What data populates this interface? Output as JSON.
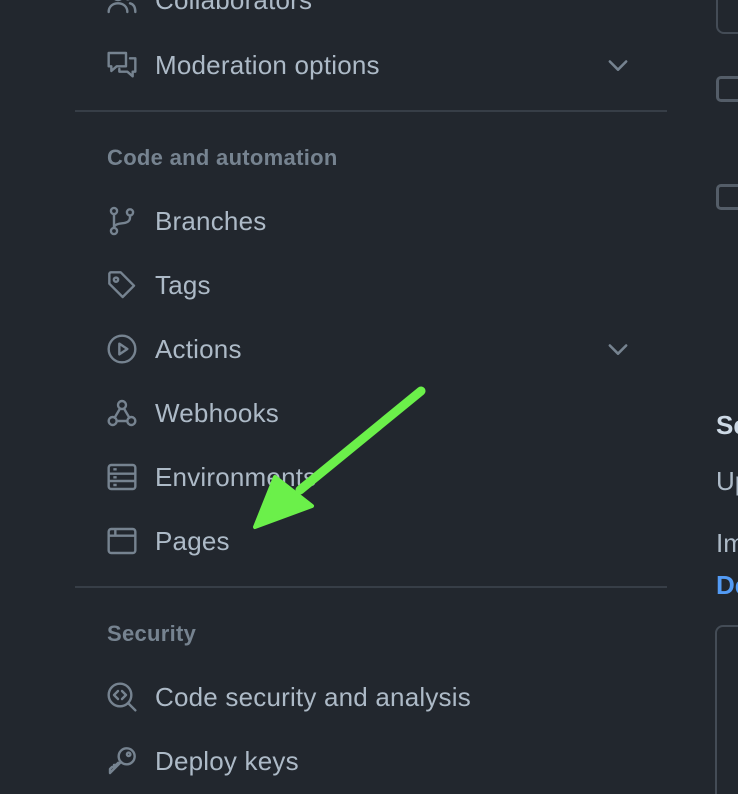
{
  "sidebar": {
    "items_top": [
      {
        "label": "Collaborators",
        "icon": "people-icon"
      },
      {
        "label": "Moderation options",
        "icon": "comment-discussion-icon",
        "expandable": true
      }
    ],
    "code_automation": {
      "heading": "Code and automation",
      "items": [
        {
          "label": "Branches",
          "icon": "git-branch-icon"
        },
        {
          "label": "Tags",
          "icon": "tag-icon"
        },
        {
          "label": "Actions",
          "icon": "play-icon",
          "expandable": true
        },
        {
          "label": "Webhooks",
          "icon": "webhook-icon"
        },
        {
          "label": "Environments",
          "icon": "server-icon"
        },
        {
          "label": "Pages",
          "icon": "browser-icon"
        }
      ]
    },
    "security": {
      "heading": "Security",
      "items": [
        {
          "label": "Code security and analysis",
          "icon": "codescan-icon"
        },
        {
          "label": "Deploy keys",
          "icon": "key-icon"
        }
      ]
    }
  },
  "right_panel": {
    "text_heading": "Se",
    "text_line1": "Up",
    "text_line2": "Im",
    "link_text": "De"
  },
  "colors": {
    "background": "#22272e",
    "text": "#adbac7",
    "muted": "#768390",
    "link": "#539bf5",
    "annotation_arrow": "#6bf04a"
  }
}
